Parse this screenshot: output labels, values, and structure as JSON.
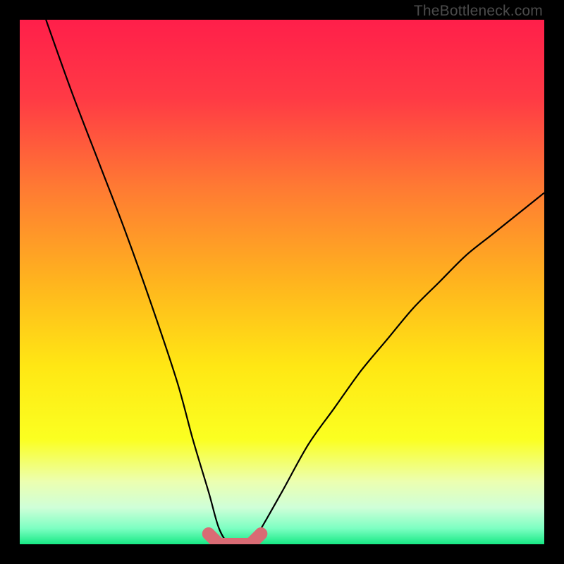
{
  "watermark": "TheBottleneck.com",
  "chart_data": {
    "type": "line",
    "title": "",
    "xlabel": "",
    "ylabel": "",
    "xlim": [
      0,
      100
    ],
    "ylim": [
      0,
      100
    ],
    "series": [
      {
        "name": "bottleneck-curve",
        "x": [
          5,
          10,
          15,
          20,
          25,
          30,
          33,
          36,
          38,
          40,
          42,
          44,
          46,
          50,
          55,
          60,
          65,
          70,
          75,
          80,
          85,
          90,
          95,
          100
        ],
        "y": [
          100,
          86,
          73,
          60,
          46,
          31,
          20,
          10,
          3,
          0,
          0,
          0,
          3,
          10,
          19,
          26,
          33,
          39,
          45,
          50,
          55,
          59,
          63,
          67
        ]
      },
      {
        "name": "flat-marker-band",
        "x": [
          36,
          38,
          40,
          42,
          44,
          46
        ],
        "y": [
          2,
          0,
          0,
          0,
          0,
          2
        ]
      }
    ],
    "gradient_stops": [
      {
        "pos": 0.0,
        "color": "#ff1f4a"
      },
      {
        "pos": 0.15,
        "color": "#ff3a45"
      },
      {
        "pos": 0.32,
        "color": "#ff7a33"
      },
      {
        "pos": 0.5,
        "color": "#ffb41e"
      },
      {
        "pos": 0.66,
        "color": "#ffe714"
      },
      {
        "pos": 0.8,
        "color": "#fbff21"
      },
      {
        "pos": 0.88,
        "color": "#ecffb0"
      },
      {
        "pos": 0.93,
        "color": "#cfffd8"
      },
      {
        "pos": 0.97,
        "color": "#7cffc2"
      },
      {
        "pos": 1.0,
        "color": "#17e884"
      }
    ],
    "curve_color": "#000000",
    "marker_color": "#d96b74"
  }
}
